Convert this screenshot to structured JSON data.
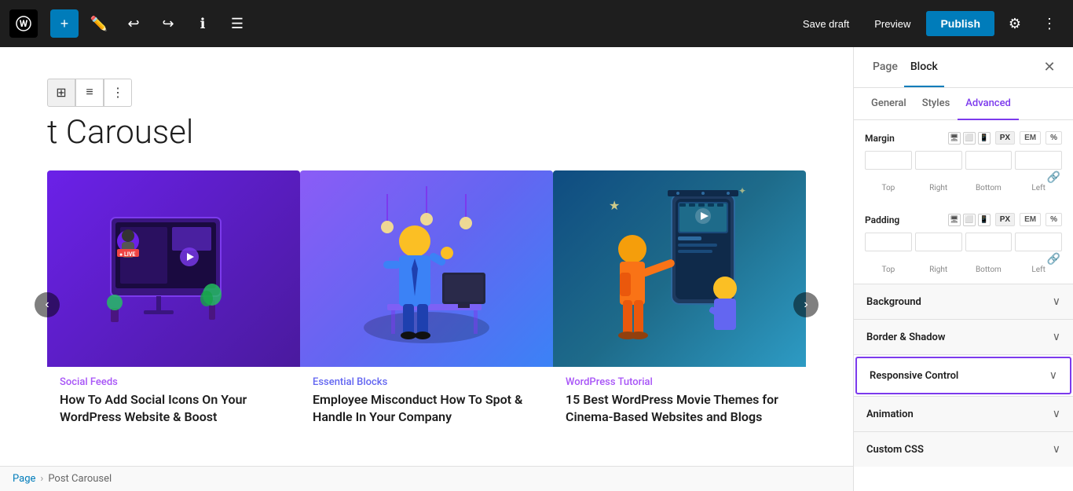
{
  "toolbar": {
    "save_draft_label": "Save draft",
    "preview_label": "Preview",
    "publish_label": "Publish"
  },
  "editor": {
    "page_title": "t Carousel",
    "breadcrumb_home": "Page",
    "breadcrumb_current": "Post Carousel"
  },
  "block_toolbar": {
    "grid_icon": "⊞",
    "align_icon": "≡",
    "more_icon": "⋮"
  },
  "carousel": {
    "cards": [
      {
        "category": "Social Feeds",
        "title": "How To Add Social Icons On Your WordPress Website & Boost",
        "theme": "purple"
      },
      {
        "category": "Essential Blocks",
        "title": "Employee Misconduct How To Spot & Handle In Your Company",
        "theme": "blue"
      },
      {
        "category": "WordPress Tutorial",
        "title": "15 Best WordPress Movie Themes for Cinema-Based Websites and Blogs",
        "theme": "dark"
      }
    ]
  },
  "right_panel": {
    "tab_page": "Page",
    "tab_block": "Block",
    "sub_tab_general": "General",
    "sub_tab_styles": "Styles",
    "sub_tab_advanced": "Advanced",
    "margin_label": "Margin",
    "padding_label": "Padding",
    "unit_px": "PX",
    "unit_em": "EM",
    "unit_percent": "%",
    "spacing_labels": [
      "Top",
      "Right",
      "Bottom",
      "Left"
    ],
    "accordion_items": [
      {
        "label": "Background",
        "active": false
      },
      {
        "label": "Border & Shadow",
        "active": false
      },
      {
        "label": "Responsive Control",
        "active": true
      },
      {
        "label": "Animation",
        "active": false
      },
      {
        "label": "Custom CSS",
        "active": false
      }
    ]
  }
}
